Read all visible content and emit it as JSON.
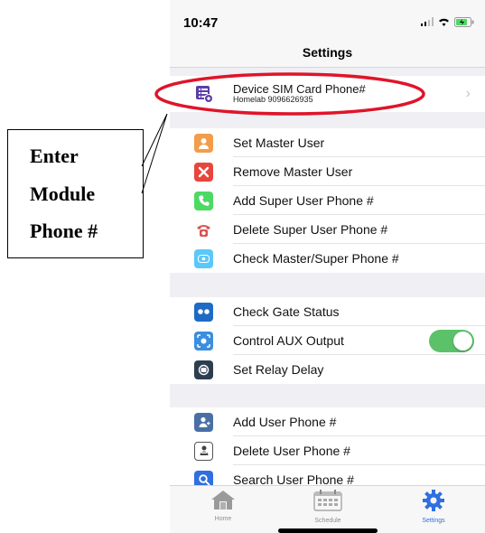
{
  "status_bar": {
    "time": "10:47"
  },
  "nav": {
    "title": "Settings"
  },
  "device": {
    "title": "Device SIM Card Phone#",
    "subtitle": "Homelab 9096626935"
  },
  "section2": [
    {
      "label": "Set Master User",
      "icon": "master-user-icon",
      "color": "#f39c4a"
    },
    {
      "label": "Remove Master User",
      "icon": "remove-user-icon",
      "color": "#e8453c"
    },
    {
      "label": "Add Super User Phone #",
      "icon": "phone-add-icon",
      "color": "#4cd964"
    },
    {
      "label": "Delete Super User Phone #",
      "icon": "phone-delete-icon",
      "color": "#d9534f"
    },
    {
      "label": "Check Master/Super Phone #",
      "icon": "check-phone-icon",
      "color": "#5ac8fa"
    }
  ],
  "section3": [
    {
      "label": "Check Gate Status",
      "icon": "gate-status-icon",
      "color": "#1e6bc6"
    },
    {
      "label": "Control AUX Output",
      "icon": "aux-output-icon",
      "color": "#3b8ee0",
      "toggle_on": true
    },
    {
      "label": "Set Relay Delay",
      "icon": "relay-delay-icon",
      "color": "#2c3e50"
    }
  ],
  "section4": [
    {
      "label": "Add User Phone #",
      "icon": "add-user-icon",
      "color": "#4a6fa5"
    },
    {
      "label": "Delete User Phone #",
      "icon": "delete-user-icon",
      "color": "#555555"
    },
    {
      "label": "Search User Phone #",
      "icon": "search-user-icon",
      "color": "#2f6fe0"
    }
  ],
  "tabs": [
    {
      "label": "Home",
      "icon": "home-icon"
    },
    {
      "label": "Schedule",
      "icon": "calendar-icon"
    },
    {
      "label": "Settings",
      "icon": "gear-icon",
      "active": true
    }
  ],
  "callout": {
    "line1": "Enter",
    "line2": "Module",
    "line3": "Phone #"
  },
  "colors": {
    "accent": "#2f6fe0",
    "toggle": "#5cc26a",
    "highlight": "#e0142a"
  }
}
